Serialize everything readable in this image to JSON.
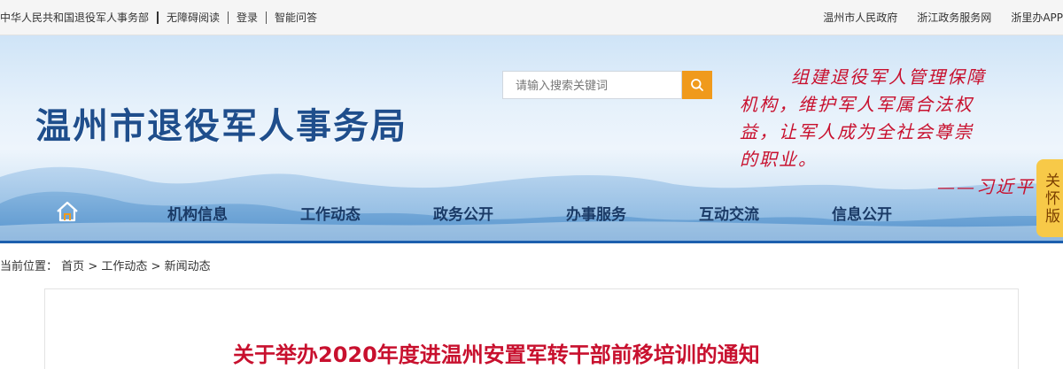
{
  "topbar": {
    "left": [
      "中华人民共和国退役军人事务部",
      "无障碍阅读",
      "登录",
      "智能问答"
    ],
    "right": [
      "温州市人民政府",
      "浙江政务服务网",
      "浙里办APP"
    ]
  },
  "site": {
    "title": "温州市退役军人事务局"
  },
  "search": {
    "placeholder": "请输入搜索关键词"
  },
  "quote": {
    "lines": [
      "组建退役军人管理保障",
      "机构，维护军人军属合法权",
      "益，让军人成为全社会尊崇",
      "的职业。"
    ],
    "author": "——习近平"
  },
  "care_mode": "关怀版",
  "nav": [
    "机构信息",
    "工作动态",
    "政务公开",
    "办事服务",
    "互动交流",
    "信息公开"
  ],
  "breadcrumb": {
    "label": "当前位置：",
    "items": [
      "首页",
      "工作动态",
      "新闻动态"
    ],
    "separator": ">"
  },
  "article": {
    "title": "关于举办2020年度进温州安置军转干部前移培训的通知"
  },
  "colors": {
    "accent": "#f09a1c",
    "title_blue": "#1f4e8c",
    "quote_red": "#c8102e",
    "nav_text": "#1a3a66",
    "care_yellow": "#f7c948"
  },
  "icons": {
    "search": "search-icon",
    "home": "home-icon"
  }
}
